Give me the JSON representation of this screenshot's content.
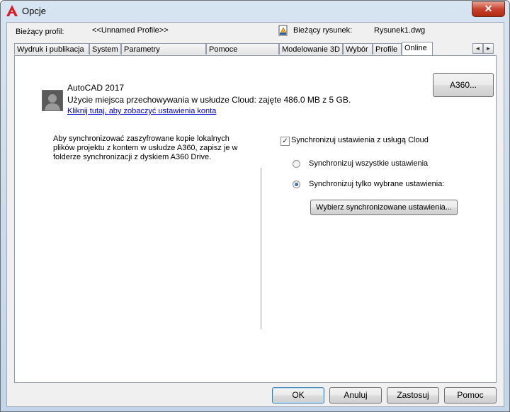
{
  "window": {
    "title": "Opcje",
    "close_glyph": "✕"
  },
  "profile": {
    "label": "Bieżący profil:",
    "value": "<<Unnamed Profile>>"
  },
  "drawing": {
    "label": "Bieżący rysunek:",
    "value": "Rysunek1.dwg",
    "icon": "drawing-file-icon"
  },
  "tabs": [
    {
      "label": "Wydruk i publikacja"
    },
    {
      "label": "System"
    },
    {
      "label": "Parametry użytkownika"
    },
    {
      "label": "Pomoce rysunkowe"
    },
    {
      "label": "Modelowanie 3D"
    },
    {
      "label": "Wybór"
    },
    {
      "label": "Profile"
    },
    {
      "label": "Online"
    }
  ],
  "tab_scroll": {
    "left": "◄",
    "right": "►"
  },
  "account": {
    "product": "AutoCAD 2017",
    "storage": "Użycie miejsca przechowywania w usłudze Cloud: zajęte 486.0 MB z 5 GB.",
    "link": "Kliknij tutaj, aby zobaczyć ustawienia konta",
    "a360_button": "A360..."
  },
  "info_text": "Aby synchronizować zaszyfrowane kopie lokalnych plików projektu z kontem w usłudze A360, zapisz je w folderze synchronizacji z dyskiem A360 Drive.",
  "sync": {
    "checkbox_label": "Synchronizuj ustawienia z usługą Cloud",
    "checked": true,
    "check_glyph": "✓",
    "option_all": "Synchronizuj wszystkie ustawienia",
    "option_selected": "Synchronizuj tylko wybrane ustawienia:",
    "selected_option": "selected",
    "choose_button": "Wybierz synchronizowane ustawienia..."
  },
  "footer": {
    "ok": "OK",
    "cancel": "Anuluj",
    "apply": "Zastosuj",
    "help": "Pomoc"
  }
}
